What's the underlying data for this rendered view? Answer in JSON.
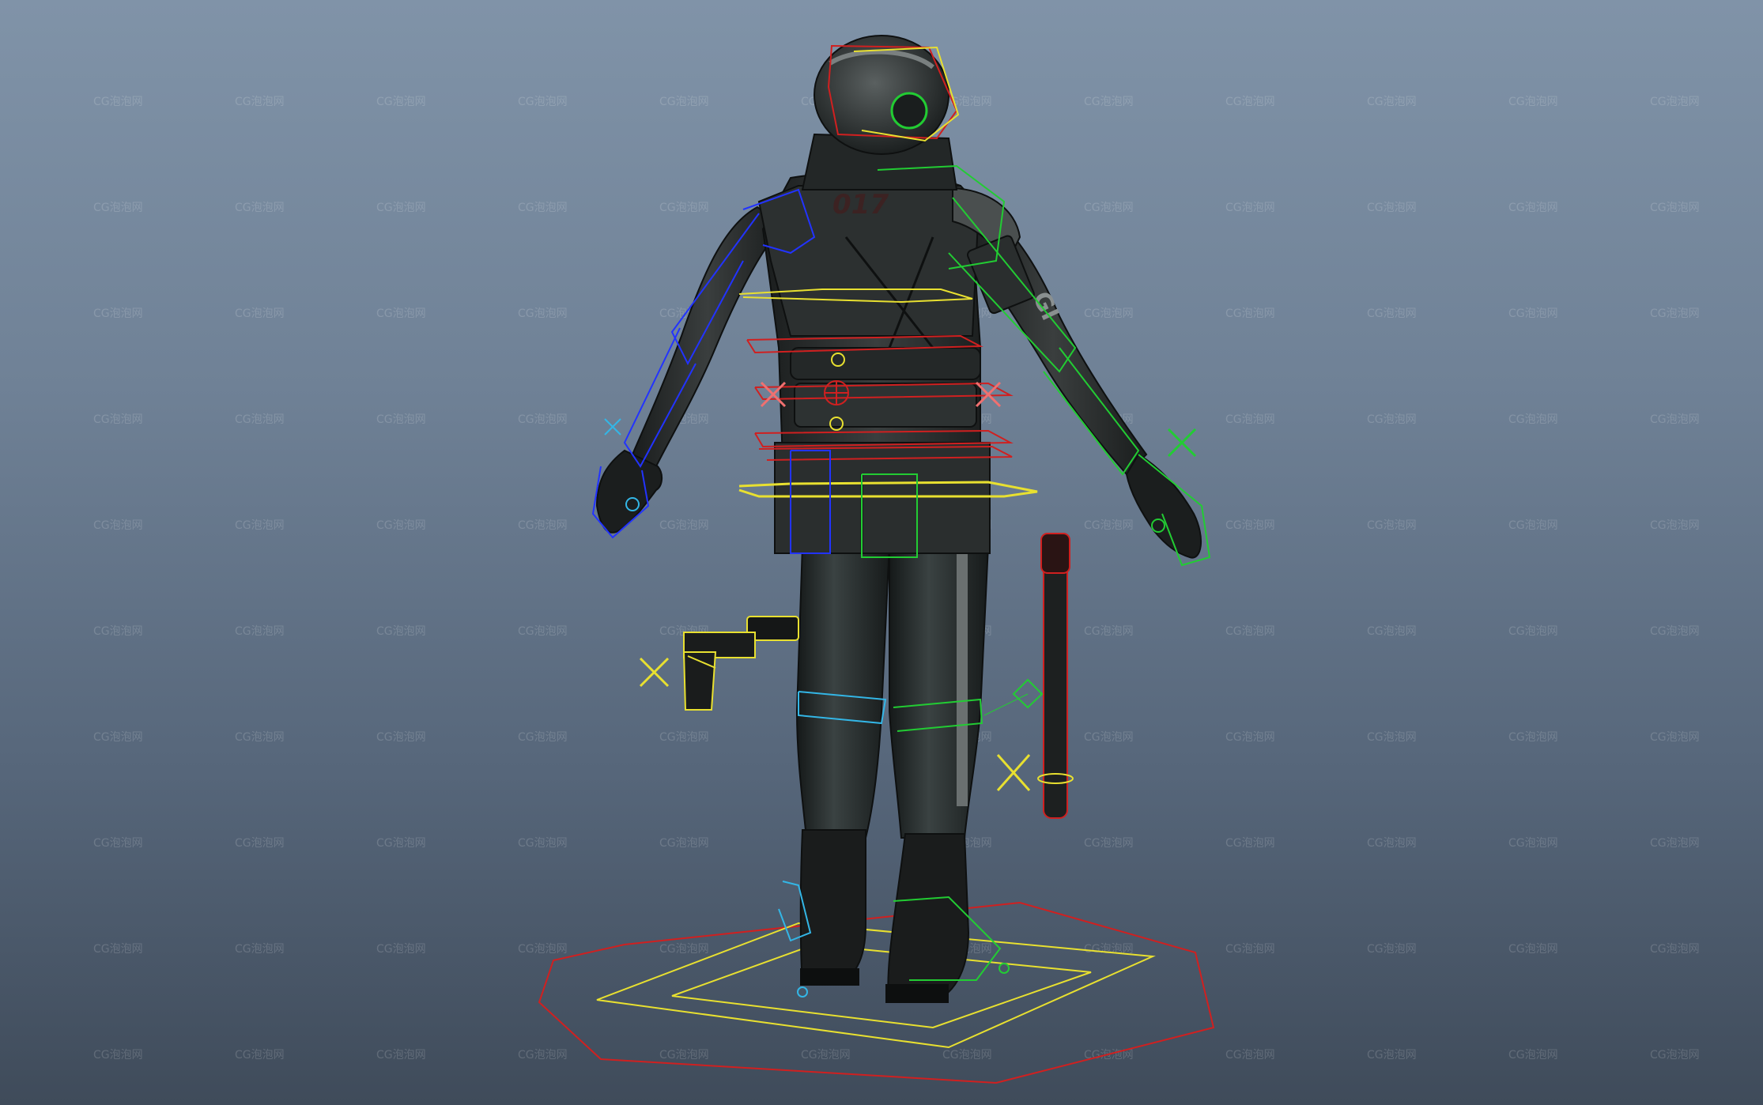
{
  "viewport": {
    "background_top": "#8093a8",
    "background_bottom": "#3f4b5a"
  },
  "watermark": {
    "text": "CG泡泡网",
    "color": "rgba(255,255,255,0.16)"
  },
  "character": {
    "jacket_number": "017",
    "sleeve_text": "GI"
  },
  "rig_colors": {
    "center": "#e01a1a",
    "right_side": "#2233ff",
    "left_side": "#22cc33",
    "spine": "#ffee22",
    "leg_ik": "#33b6e6",
    "ground": "#d02020"
  },
  "icons": {
    "pistol": "pistol-prop",
    "baton": "baton-prop",
    "locator": "cross-locator"
  }
}
